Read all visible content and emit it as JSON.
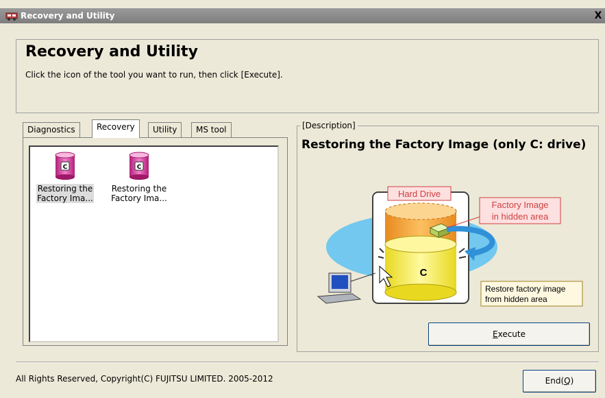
{
  "window": {
    "title": "Recovery and Utility",
    "close_glyph": "X"
  },
  "header": {
    "title": "Recovery and Utility",
    "instruction": "Click the icon of the tool you want to run, then click [Execute]."
  },
  "tabs": [
    {
      "label": "Diagnostics",
      "active": false
    },
    {
      "label": "Recovery",
      "active": true
    },
    {
      "label": "Utility",
      "active": false
    },
    {
      "label": "MS tool",
      "active": false
    }
  ],
  "tools": [
    {
      "icon": "drive-c-icon",
      "label_line1": "Restoring the",
      "label_line2": "Factory Ima...",
      "selected": true
    },
    {
      "icon": "drive-c-icon",
      "label_line1": "Restoring the",
      "label_line2": "Factory Ima...",
      "selected": false
    }
  ],
  "description": {
    "legend": "[Description]",
    "title": "Restoring the Factory Image (only C: drive)",
    "illustration": {
      "drive_label": "Hard Drive",
      "factory_image_label_1": "Factory Image",
      "factory_image_label_2": "in hidden area",
      "c_label": "C",
      "restore_label_1": "Restore factory image",
      "restore_label_2": "from hidden area"
    }
  },
  "buttons": {
    "execute_prefix": "",
    "execute_mnemonic": "E",
    "execute_rest": "xecute",
    "end_prefix": "End(",
    "end_mnemonic": "Q",
    "end_suffix": ")"
  },
  "footer": {
    "copyright": "All Rights Reserved, Copyright(C) FUJITSU LIMITED. 2005-2012"
  },
  "colors": {
    "title_bar": "#8a8a8a",
    "window_bg": "#ece9d8",
    "cylinder_pink": "#e060b0",
    "drive_orange": "#f5a030",
    "drive_yellow": "#f5ee40",
    "ellipse_blue": "#6ec8ee",
    "label_red": "#d04040"
  }
}
